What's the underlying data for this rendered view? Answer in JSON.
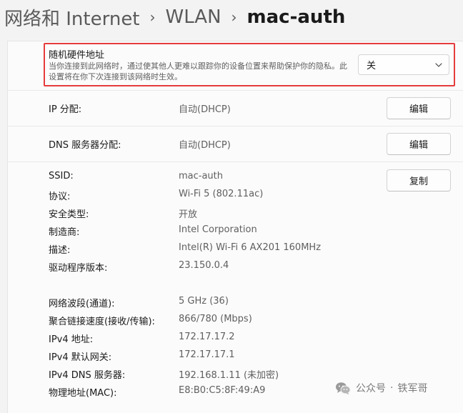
{
  "breadcrumb": {
    "items": [
      "网络和 Internet",
      "WLAN"
    ],
    "current": "mac-auth",
    "separator": "›"
  },
  "random_mac": {
    "title": "随机硬件地址",
    "description": "当你连接到此网络时，通过使其他人更难以跟踪你的设备位置来帮助保护你的隐私。此设置将在你下次连接到该网络时生效。",
    "selected": "关"
  },
  "ip_assignment": {
    "label": "IP 分配:",
    "value": "自动(DHCP)",
    "button": "编辑"
  },
  "dns_assignment": {
    "label": "DNS 服务器分配:",
    "value": "自动(DHCP)",
    "button": "编辑"
  },
  "copy_button": "复制",
  "properties": [
    {
      "label": "SSID:",
      "value": "mac-auth"
    },
    {
      "label": "协议:",
      "value": "Wi-Fi 5 (802.11ac)"
    },
    {
      "label": "安全类型:",
      "value": "开放"
    },
    {
      "label": "制造商:",
      "value": "Intel Corporation"
    },
    {
      "label": "描述:",
      "value": "Intel(R) Wi-Fi 6 AX201 160MHz"
    },
    {
      "label": "驱动程序版本:",
      "value": "23.150.0.4"
    },
    {
      "label": "网络波段(通道):",
      "value": "5 GHz (36)"
    },
    {
      "label": "聚合链接速度(接收/传输):",
      "value": "866/780 (Mbps)"
    },
    {
      "label": "IPv4 地址:",
      "value": "172.17.17.2"
    },
    {
      "label": "IPv4 默认网关:",
      "value": "172.17.17.1"
    },
    {
      "label": "IPv4 DNS 服务器:",
      "value": "192.168.1.11 (未加密)"
    },
    {
      "label": "物理地址(MAC):",
      "value": "E8:B0:C5:8F:49:A9"
    }
  ],
  "watermark": {
    "platform": "公众号",
    "separator": "·",
    "author": "铁军哥"
  },
  "colors": {
    "highlight": "#e53c3c",
    "panel": "#fbfbfb",
    "background": "#f3f3f3"
  },
  "icons": {
    "dropdown": "chevron-down-icon",
    "watermark": "wechat-logo-icon"
  }
}
